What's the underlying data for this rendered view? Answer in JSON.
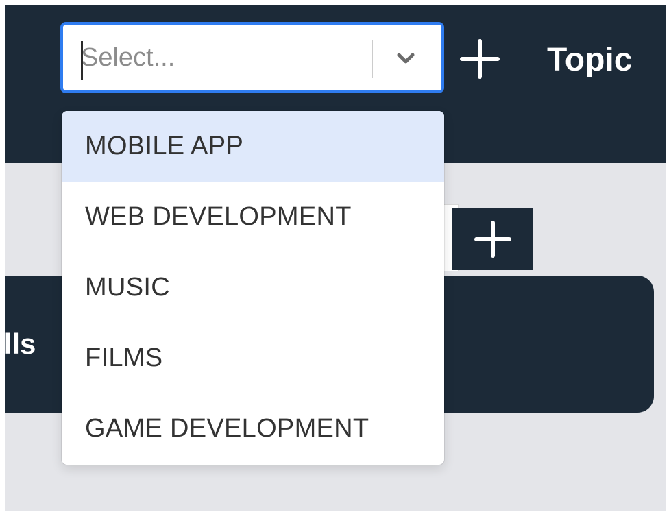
{
  "header": {
    "select": {
      "placeholder": "Select...",
      "value": ""
    },
    "add_icon": "plus-icon",
    "topic_label": "Topic"
  },
  "skills": {
    "add_icon": "plus-icon",
    "card_title_partial": "ills"
  },
  "dropdown": {
    "toggle_icon": "chevron-down-icon",
    "highlighted_index": 0,
    "options": [
      {
        "label": "MOBILE APP"
      },
      {
        "label": "WEB DEVELOPMENT"
      },
      {
        "label": "MUSIC"
      },
      {
        "label": "FILMS"
      },
      {
        "label": "GAME DEVELOPMENT"
      }
    ]
  },
  "colors": {
    "navy": "#1c2a38",
    "focus_blue": "#2f7cf0",
    "option_highlight": "#dfe9fb",
    "page_bg": "#e4e5e9"
  }
}
